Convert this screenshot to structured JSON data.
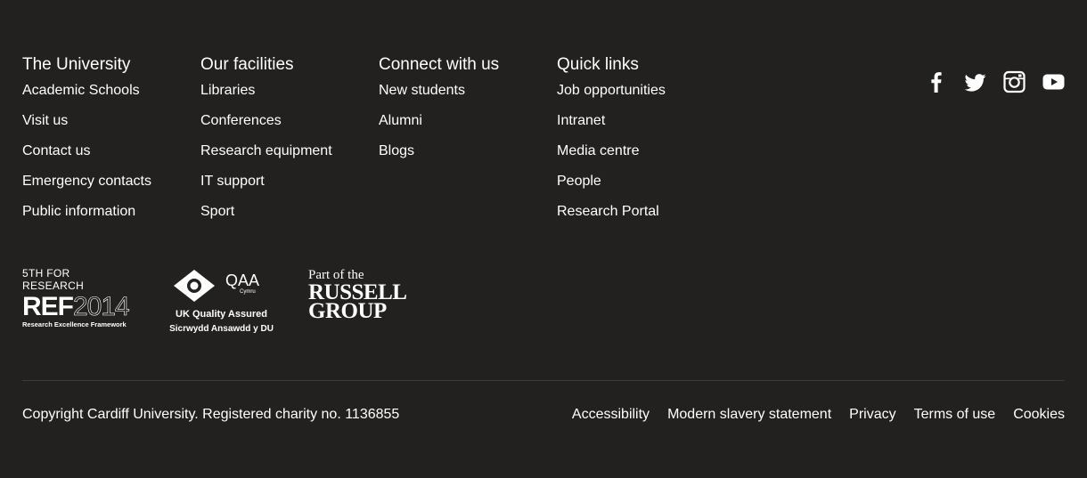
{
  "columns": [
    {
      "heading": "The University",
      "links": [
        "Academic Schools",
        "Visit us",
        "Contact us",
        "Emergency contacts",
        "Public information"
      ]
    },
    {
      "heading": "Our facilities",
      "links": [
        "Libraries",
        "Conferences",
        "Research equipment",
        "IT support",
        "Sport"
      ]
    },
    {
      "heading": "Connect with us",
      "links": [
        "New students",
        "Alumni",
        "Blogs"
      ]
    },
    {
      "heading": "Quick links",
      "links": [
        "Job opportunities",
        "Intranet",
        "Media centre",
        "People",
        "Research Portal"
      ]
    }
  ],
  "social": [
    "facebook-icon",
    "twitter-icon",
    "instagram-icon",
    "youtube-icon"
  ],
  "logos": {
    "ref": {
      "top": "5TH FOR RESEARCH",
      "ref": "REF",
      "year": "2014",
      "sub": "Research Excellence Framework"
    },
    "qaa": {
      "name": "QAA",
      "cymru": "Cymru",
      "line1": "UK Quality Assured",
      "line2": "Sicrwydd Ansawdd y DU"
    },
    "russell": {
      "part": "Part of the",
      "name1": "RUSSELL",
      "name2": "GROUP"
    }
  },
  "footer": {
    "copyright": "Copyright Cardiff University. Registered charity no. 1136855",
    "legal_links": [
      "Accessibility",
      "Modern slavery statement",
      "Privacy",
      "Terms of use",
      "Cookies"
    ]
  },
  "colors": {
    "background": "#222120",
    "text": "#ffffff",
    "divider": "#3d3c3a"
  }
}
